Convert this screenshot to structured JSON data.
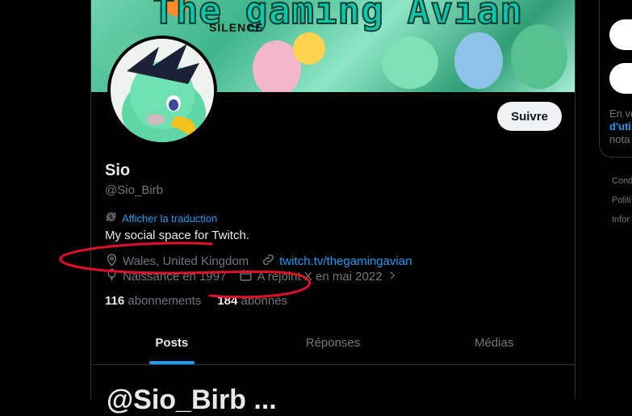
{
  "banner": {
    "title": "The gaming Avian",
    "subtitle": "SILENCE"
  },
  "profile": {
    "name": "Sio",
    "handle": "@Sio_Birb",
    "follow_label": "Suivre",
    "translate_label": "Afficher la traduction",
    "bio": "My social space for Twitch.",
    "location": "Wales, United Kingdom",
    "link": "twitch.tv/thegamingavian",
    "birth": "Naissance en 1997",
    "joined": "A rejoint X en mai 2022",
    "following_count": "116",
    "following_label": "abonnements",
    "followers_count": "184",
    "followers_label": "abonnés"
  },
  "tabs": [
    {
      "label": "Posts"
    },
    {
      "label": "Réponses"
    },
    {
      "label": "Médias"
    }
  ],
  "next_post_text": "@Sio_Birb ...",
  "right_panel": {
    "text_line1": "En vo",
    "text_link": "d'uti",
    "text_line3": "nota"
  },
  "footer": [
    "Cond",
    "Politi",
    "Infor"
  ],
  "colors": {
    "accent": "#1d9bf0",
    "annotation": "#e0102a",
    "background": "#000000"
  },
  "icons": [
    "location-icon",
    "link-icon",
    "balloon-icon",
    "calendar-icon",
    "translate-icon",
    "chevron-right-icon"
  ]
}
